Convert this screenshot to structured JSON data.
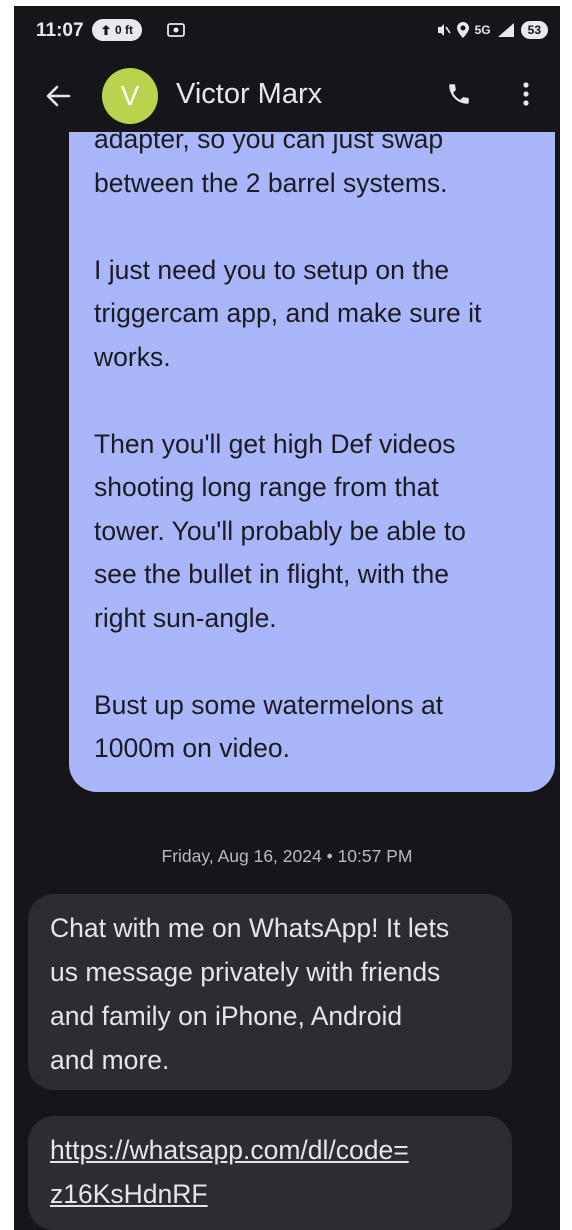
{
  "status_bar": {
    "time": "11:07",
    "data_speed": "0 ft",
    "network": "5G",
    "battery": "53"
  },
  "header": {
    "avatar_letter": "V",
    "contact_name": "Victor Marx",
    "colors": {
      "avatar": "#b8d34e",
      "background": "#15151a"
    }
  },
  "conversation": {
    "outgoing": {
      "color": "#a9b6f9",
      "paragraphs": [
        [
          "adapter, so you can just swap",
          "between the 2 barrel systems."
        ],
        [
          "I just need you to setup on the",
          "triggercam app, and make sure it",
          "works."
        ],
        [
          "Then you'll get high Def videos",
          "shooting long range from that",
          "tower. You'll probably be able to",
          "see the bullet in flight, with the",
          "right sun-angle."
        ],
        [
          "Bust up some watermelons at",
          "1000m on video."
        ]
      ]
    },
    "timestamp": "Friday, Aug 16, 2024 • 10:57 PM",
    "incoming": [
      {
        "lines": [
          "Chat with me on WhatsApp! It lets",
          "us message privately with friends",
          "and family on iPhone, Android",
          "and more."
        ]
      },
      {
        "link_lines": [
          "https://whatsapp.com/dl/code=",
          "z16KsHdnRF"
        ]
      }
    ]
  }
}
